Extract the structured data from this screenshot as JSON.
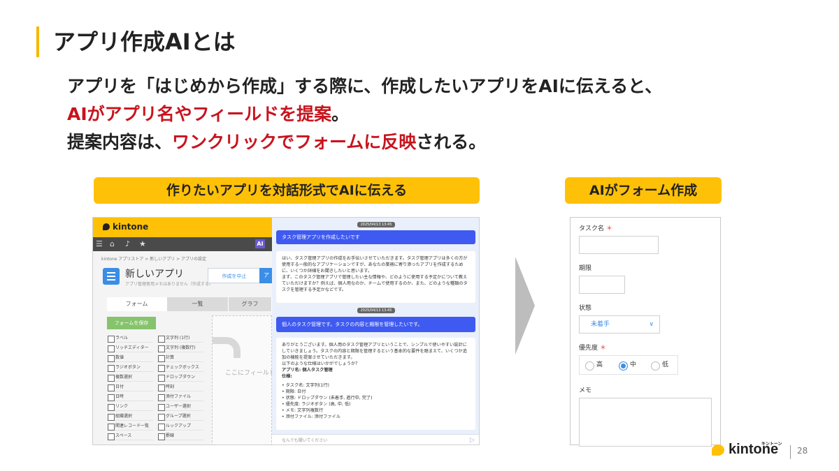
{
  "slide": {
    "title": "アプリ作成AIとは",
    "lead_line1": "アプリを「はじめから作成」する際に、作成したいアプリをAIに伝えると、",
    "lead_line2_red": "AIがアプリ名やフィールドを提案",
    "lead_line2_rest": "。",
    "lead_line3_a": "提案内容は、",
    "lead_line3_red": "ワンクリックでフォームに反映",
    "lead_line3_b": "される。",
    "pill_left": "作りたいアプリを対話形式でAIに伝える",
    "pill_right": "AIがフォーム作成",
    "page_number": "28",
    "accent_color": "#f5b800",
    "highlight_color": "#c8141e"
  },
  "kintone_ui": {
    "logo": "kintone",
    "ai_badge": "AI",
    "breadcrumb": "kintone アプリストア  >  新しいアプリ  >  アプリの設定",
    "app_title": "新しいアプリ",
    "app_sub": "アプリ管理者用メモはありません（作成する）",
    "cancel_button": "作成を中止",
    "apply_button": "ア",
    "tabs": [
      "フォーム",
      "一覧",
      "グラフ"
    ],
    "save_button": "フォームを保存",
    "palette": [
      "ラベル",
      "文字列 (1行)",
      "リッチエディター",
      "文字列 (複数行)",
      "数値",
      "計算",
      "ラジオボタン",
      "チェックボックス",
      "複数選択",
      "ドロップダウン",
      "日付",
      "時刻",
      "日時",
      "添付ファイル",
      "リンク",
      "ユーザー選択",
      "組織選択",
      "グループ選択",
      "関連レコード一覧",
      "ルックアップ",
      "スペース",
      "罫線"
    ],
    "drop_text": "ここにフィールド"
  },
  "chat": {
    "timestamp1": "2025/04/13 13:45",
    "user1": "タスク管理アプリを作成したいです",
    "ai1": [
      "はい、タスク管理アプリの作成をお手伝いさせていただきます。タスク管理アプリは多くの方が使用する一般的なアプリケーションですが、あなたの業務に寄り添ったアプリを作成するために、いくつか詳細をお聞きしたいと思います。",
      "まず、このタスク管理アプリで管理したい主な情報や、どのように使用する予定かについて教えていただけますか？例えば、個人用なのか、チームで使用するのか、また、どのような種類のタスクを管理する予定かなどです。"
    ],
    "timestamp2": "2025/04/13 13:45",
    "user2": "個人のタスク管理です。タスクの内容と期限を管理したいです。",
    "ai2_intro": "ありがとうございます。個人用のタスク管理アプリということで、シンプルで使いやすい設計にしていきましょう。タスクの内容と期限を管理するという基本的な要件を踏まえて、いくつか追加の機能を提案させていただきます。",
    "ai2_question": "以下のような仕様はいかがでしょうか？",
    "ai2_appname": "アプリ名: 個人タスク管理",
    "ai2_spec": "仕様:",
    "ai2_items": [
      "タスク名: 文字列(1行)",
      "期限: 日付",
      "状態: ドロップダウン (未着手, 進行中, 完了)",
      "優先度: ラジオボタン (高, 中, 低)",
      "メモ: 文字列複数行",
      "添付ファイル: 添付ファイル"
    ],
    "input_placeholder": "なんでも聞いてください",
    "send_icon": "▷"
  },
  "form": {
    "task_name_label": "タスク名",
    "deadline_label": "期限",
    "status_label": "状態",
    "status_value": "未着手",
    "priority_label": "優先度",
    "priority_options": [
      "高",
      "中",
      "低"
    ],
    "priority_selected": "中",
    "memo_label": "メモ",
    "required_mark": "＊"
  },
  "brand": {
    "name": "kintone",
    "kana": "キントーン"
  }
}
